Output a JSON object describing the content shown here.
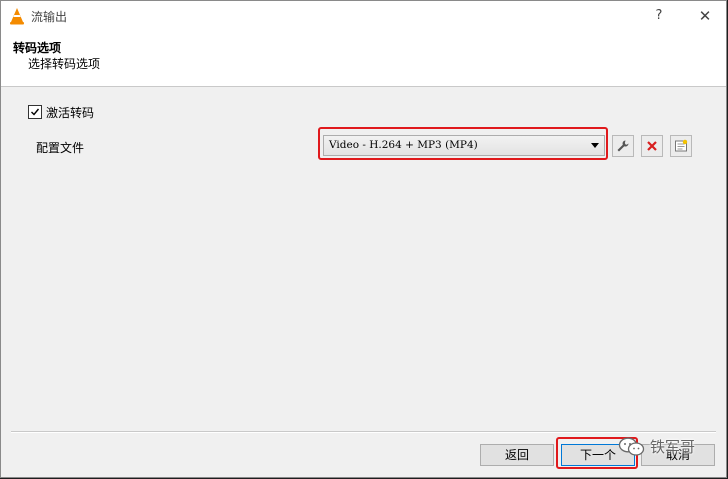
{
  "window": {
    "title": "流输出",
    "help_glyph": "?",
    "close_glyph": "✕",
    "app_icon": "vlc-cone-icon"
  },
  "header": {
    "title": "转码选项",
    "subtitle": "选择转码选项"
  },
  "transcode": {
    "activate_label": "激活转码",
    "activate_checked": true
  },
  "profile": {
    "label": "配置文件",
    "selected": "Video - H.264 + MP3 (MP4)",
    "edit_icon": "wrench-icon",
    "delete_icon": "delete-x-icon",
    "new_icon": "new-profile-icon"
  },
  "footer": {
    "back_label": "返回",
    "next_label": "下一个",
    "cancel_label": "取消"
  },
  "watermark": {
    "text": "铁军哥",
    "icon": "wechat-icon"
  },
  "colors": {
    "highlight": "#e0191c",
    "accent": "#0078d7",
    "window_bg": "#f0f0f0"
  }
}
